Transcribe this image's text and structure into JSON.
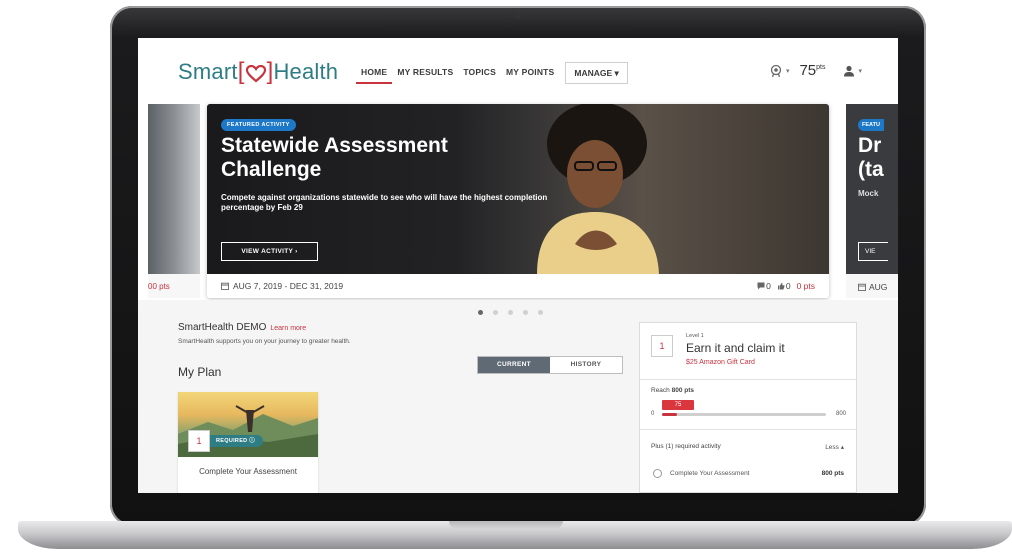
{
  "header": {
    "logo": {
      "left": "Smart",
      "bracket_open": "[",
      "bracket_close": "]",
      "right": "Health"
    },
    "nav": [
      "HOME",
      "MY RESULTS",
      "TOPICS",
      "MY POINTS"
    ],
    "manage_label": "MANAGE ▾",
    "points_value": "75",
    "points_unit": "pts",
    "caret": "▾"
  },
  "carousel": {
    "left_card_points": "00 pts",
    "featured": {
      "badge": "FEATURED ACTIVITY",
      "title": "Statewide Assessment Challenge",
      "description": "Compete against organizations statewide to see who will have the highest completion percentage by Feb 29",
      "button": "VIEW ACTIVITY ›",
      "date_range": "AUG 7, 2019 - DEC 31, 2019",
      "comments": "0",
      "likes": "0",
      "points": "0 pts"
    },
    "right_card": {
      "badge": "FEATU",
      "title_line1": "Dr",
      "title_line2": "(ta",
      "subtitle": "Mock",
      "button": "VIE",
      "date": "AUG"
    },
    "dot_count": 5,
    "active_dot": 0
  },
  "program": {
    "name": "SmartHealth DEMO",
    "learn_more": "Learn more",
    "tagline": "SmartHealth supports you on your journey to greater health.",
    "plan_heading": "My Plan",
    "tabs": [
      "CURRENT",
      "HISTORY"
    ],
    "active_tab": 0,
    "plan_card": {
      "number": "1",
      "required_label": "REQUIRED",
      "title": "Complete Your Assessment"
    }
  },
  "reward": {
    "number": "1",
    "level": "Level 1",
    "title": "Earn it and claim it",
    "gift": "$25 Amazon Gift Card",
    "reach_prefix": "Reach",
    "reach_points": "800 pts",
    "progress_min": "0",
    "progress_max": "800",
    "progress_value": "75",
    "progress_fraction": 0.094,
    "plus_required": "Plus (1) required activity",
    "toggle": "Less ▴",
    "activity": "Complete Your Assessment",
    "activity_points": "800 pts"
  },
  "colors": {
    "brand_teal": "#2f7d84",
    "brand_red": "#c8333e",
    "badge_blue": "#1e78c8",
    "tab_active": "#5f6a74"
  }
}
